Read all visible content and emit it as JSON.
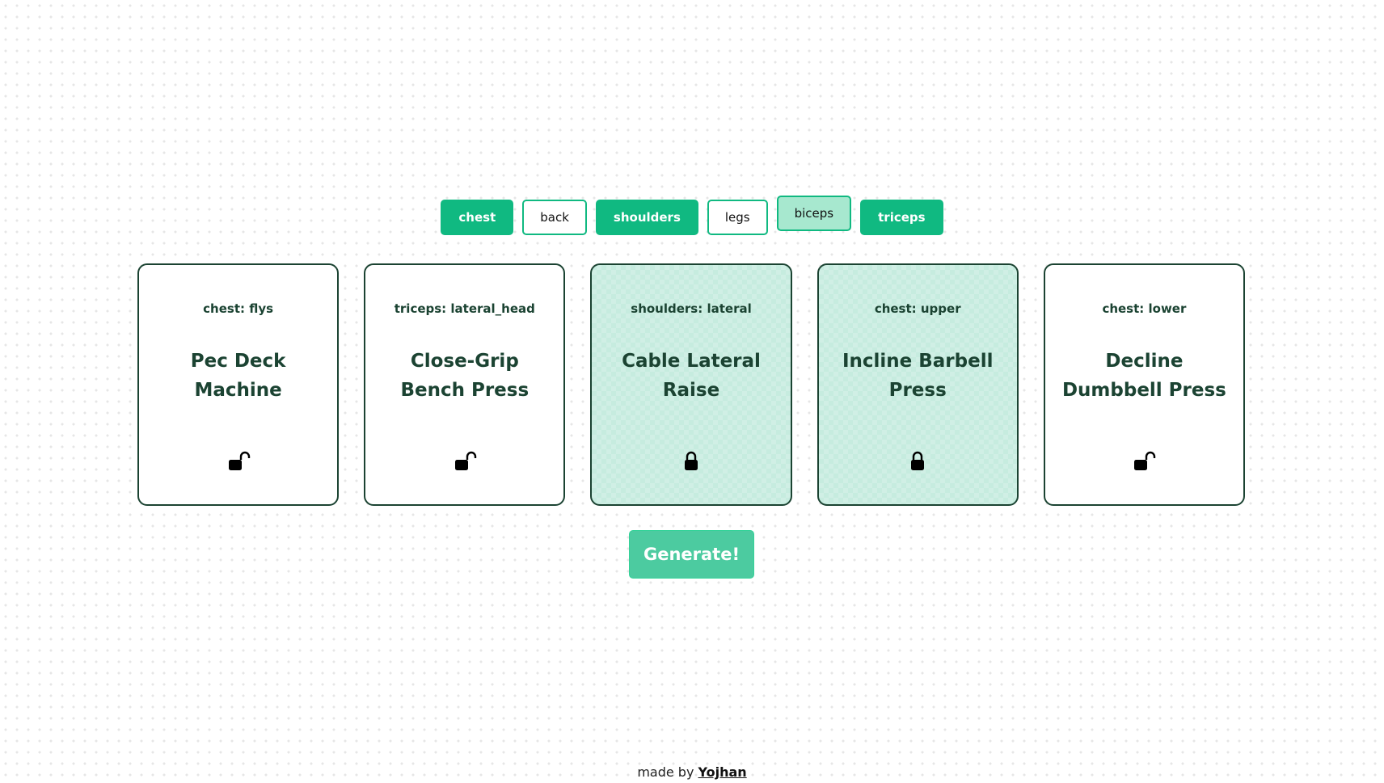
{
  "filters": [
    {
      "label": "chest",
      "state": "active"
    },
    {
      "label": "back",
      "state": "inactive"
    },
    {
      "label": "shoulders",
      "state": "active"
    },
    {
      "label": "legs",
      "state": "inactive"
    },
    {
      "label": "biceps",
      "state": "hovered"
    },
    {
      "label": "triceps",
      "state": "active"
    }
  ],
  "cards": [
    {
      "category": "chest: flys",
      "name": "Pec Deck Machine",
      "locked": false,
      "icon": "unlock-icon"
    },
    {
      "category": "triceps: lateral_head",
      "name": "Close-Grip Bench Press",
      "locked": false,
      "icon": "unlock-icon"
    },
    {
      "category": "shoulders: lateral",
      "name": "Cable Lateral Raise",
      "locked": true,
      "icon": "lock-icon"
    },
    {
      "category": "chest: upper",
      "name": "Incline Barbell Press",
      "locked": true,
      "icon": "lock-icon"
    },
    {
      "category": "chest: lower",
      "name": "Decline Dumbbell Press",
      "locked": false,
      "icon": "unlock-icon"
    }
  ],
  "generate": {
    "label": "Generate!"
  },
  "footer": {
    "prefix": "made by ",
    "author": "Yojhan"
  },
  "colors": {
    "accent": "#10b981",
    "accent_light": "#a7e8cf",
    "card_locked_bg": "#c6ecdf",
    "card_border": "#1b4332",
    "text_dark_green": "#1b4332",
    "generate_bg": "#4ccba0"
  }
}
